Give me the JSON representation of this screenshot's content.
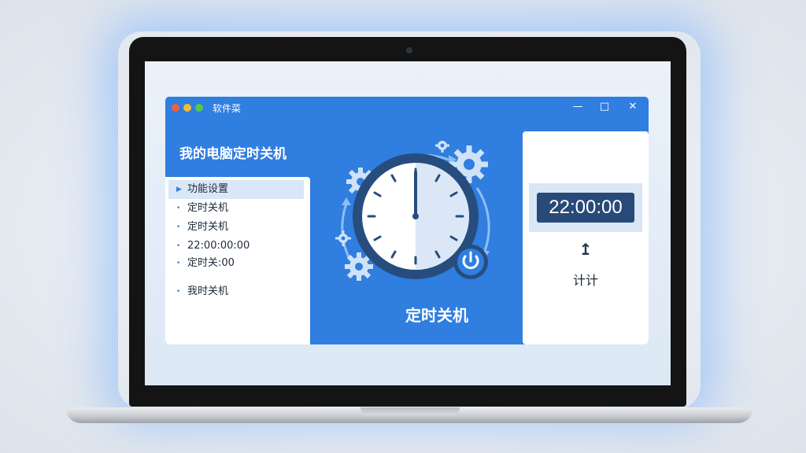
{
  "window": {
    "app_title": "软件菜",
    "heading": "我的电脑定时关机"
  },
  "sidebar": {
    "items": [
      {
        "label": "功能设置",
        "selected": true
      },
      {
        "label": "定时关机"
      },
      {
        "label": "定时关机"
      },
      {
        "label": "22:00:00:00"
      },
      {
        "label": "定时关:00"
      },
      {
        "label": "我时关机"
      }
    ]
  },
  "hero": {
    "title": "定时关机"
  },
  "right_panel": {
    "time": "22:00:00",
    "count_label": "计计"
  },
  "colors": {
    "window_blue": "#2f7ee0",
    "clock_ring": "#274d7e",
    "time_display_bg": "#284a78"
  },
  "icons": {
    "main": "clock-icon",
    "gears": "gear-icon",
    "power": "power-icon",
    "arrow": "up-arrow-icon"
  }
}
